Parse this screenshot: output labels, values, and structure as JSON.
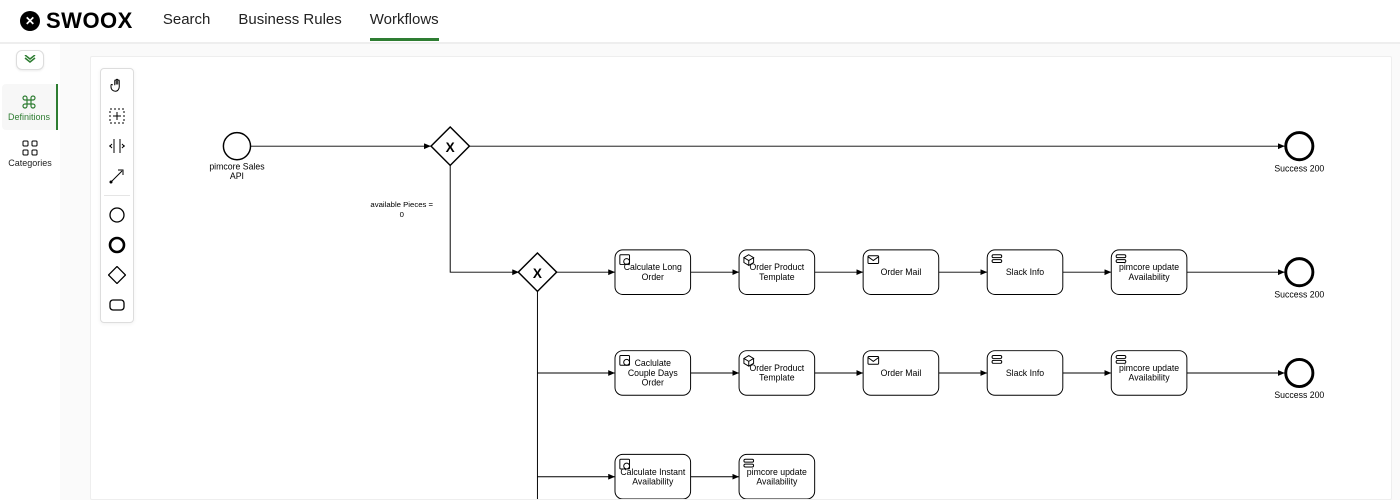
{
  "nav": {
    "brand": "SWOOX",
    "links": [
      "Search",
      "Business Rules",
      "Workflows"
    ],
    "active_index": 2
  },
  "leftrail": {
    "items": [
      {
        "label": "Definitions",
        "active": true
      },
      {
        "label": "Categories",
        "active": false
      }
    ]
  },
  "palette": {
    "tools": [
      "hand",
      "lasso",
      "space",
      "connect",
      "start-event",
      "end-event",
      "gateway",
      "task"
    ]
  },
  "diagram": {
    "start_event": {
      "label": "pimcore Sales\nAPI"
    },
    "gateway1_label": "available Pieces =\n0",
    "gateways": [
      {
        "id": "g1",
        "symbol": "X"
      },
      {
        "id": "g2",
        "symbol": "X"
      }
    ],
    "end_events": [
      {
        "id": "e1",
        "label": "Success 200"
      },
      {
        "id": "e2",
        "label": "Success 200"
      },
      {
        "id": "e3",
        "label": "Success 200"
      }
    ],
    "row1_tasks": [
      {
        "label": "Calculate Long\nOrder",
        "icon": "calc"
      },
      {
        "label": "Order Product\nTemplate",
        "icon": "cube"
      },
      {
        "label": "Order Mail",
        "icon": "mail"
      },
      {
        "label": "Slack Info",
        "icon": "bars"
      },
      {
        "label": "pimcore update\nAvailability",
        "icon": "bars"
      }
    ],
    "row2_tasks": [
      {
        "label": "Caclulate\nCouple Days\nOrder",
        "icon": "calc"
      },
      {
        "label": "Order Product\nTemplate",
        "icon": "cube"
      },
      {
        "label": "Order Mail",
        "icon": "mail"
      },
      {
        "label": "Slack Info",
        "icon": "bars"
      },
      {
        "label": "pimcore update\nAvailability",
        "icon": "bars"
      }
    ],
    "row3_tasks": [
      {
        "label": "Calculate Instant\nAvailability",
        "icon": "calc"
      },
      {
        "label": "pimcore update\nAvailability",
        "icon": "bars"
      }
    ]
  }
}
